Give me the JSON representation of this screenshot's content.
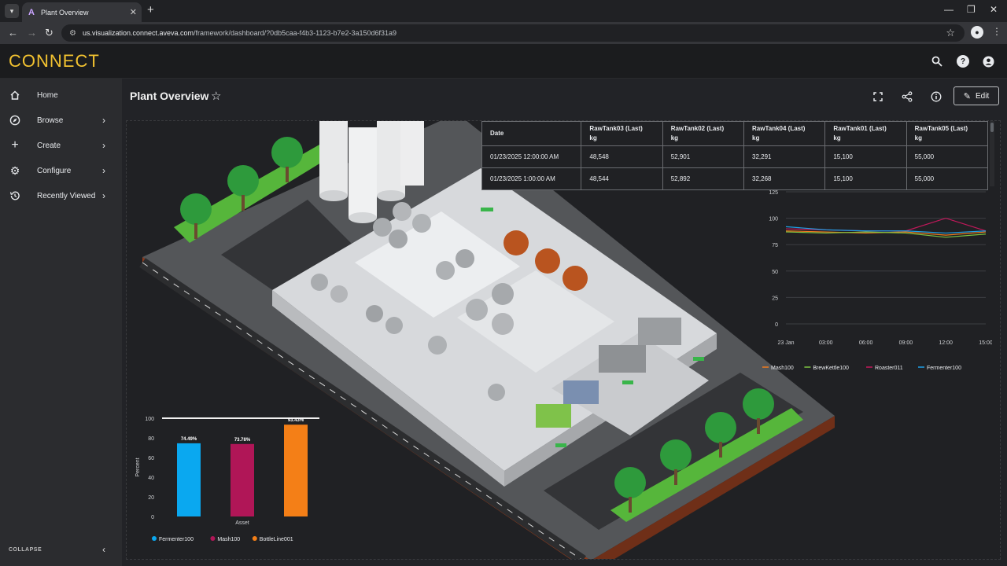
{
  "browser": {
    "tab_title": "Plant Overview",
    "url_host": "us.visualization.connect.aveva.com",
    "url_path": "/framework/dashboard/?0db5caa-f4b3-1123-b7e2-3a150d6f31a9"
  },
  "app": {
    "logo": "CONNECT"
  },
  "sidebar": {
    "items": [
      {
        "label": "Home",
        "icon": "home-icon"
      },
      {
        "label": "Browse",
        "icon": "compass-icon"
      },
      {
        "label": "Create",
        "icon": "plus-icon"
      },
      {
        "label": "Configure",
        "icon": "gear-icon"
      },
      {
        "label": "Recently Viewed",
        "icon": "history-icon"
      }
    ],
    "collapse_label": "COLLAPSE"
  },
  "page": {
    "title": "Plant Overview",
    "edit_label": "Edit"
  },
  "table": {
    "headers": [
      {
        "line1": "Date",
        "line2": ""
      },
      {
        "line1": "RawTank03 (Last)",
        "line2": "kg"
      },
      {
        "line1": "RawTank02 (Last)",
        "line2": "kg"
      },
      {
        "line1": "RawTank04 (Last)",
        "line2": "kg"
      },
      {
        "line1": "RawTank01 (Last)",
        "line2": "kg"
      },
      {
        "line1": "RawTank05 (Last)",
        "line2": "kg"
      }
    ],
    "rows": [
      [
        "01/23/2025 12:00:00 AM",
        "48,548",
        "52,901",
        "32,291",
        "15,100",
        "55,000"
      ],
      [
        "01/23/2025 1:00:00 AM",
        "48,544",
        "52,892",
        "32,268",
        "15,100",
        "55,000"
      ]
    ]
  },
  "chart_data": [
    {
      "type": "line",
      "x": [
        "23 Jan",
        "03:00",
        "06:00",
        "09:00",
        "12:00",
        "15:00"
      ],
      "ylim": [
        0,
        125
      ],
      "yticks": [
        0,
        25,
        50,
        75,
        100,
        125
      ],
      "series": [
        {
          "name": "Mash100",
          "color": "#f07c1f",
          "values": [
            88,
            87,
            86,
            87,
            84,
            87
          ]
        },
        {
          "name": "BrewKettle100",
          "color": "#7cc242",
          "values": [
            87,
            86,
            87,
            86,
            82,
            85
          ]
        },
        {
          "name": "Roaster011",
          "color": "#c2185b",
          "values": [
            90,
            89,
            88,
            88,
            100,
            88
          ]
        },
        {
          "name": "Fermenter100",
          "color": "#1e9fe6",
          "values": [
            92,
            89,
            88,
            88,
            86,
            88
          ]
        }
      ],
      "grid": true,
      "legend": "bottom"
    },
    {
      "type": "bar",
      "categories": [
        "Fermenter100",
        "Mash100",
        "BottleLine001"
      ],
      "values": [
        74.49,
        73.78,
        93.43
      ],
      "labels": [
        "74.49%",
        "73.78%",
        "93.43%"
      ],
      "colors": [
        "#0aa8f0",
        "#b01657",
        "#f47f17"
      ],
      "xlabel": "Asset",
      "ylabel": "Percent",
      "ylim": [
        0,
        100
      ],
      "yticks": [
        0,
        20,
        40,
        60,
        80,
        100
      ],
      "target": 100,
      "legend": "bottom"
    }
  ]
}
